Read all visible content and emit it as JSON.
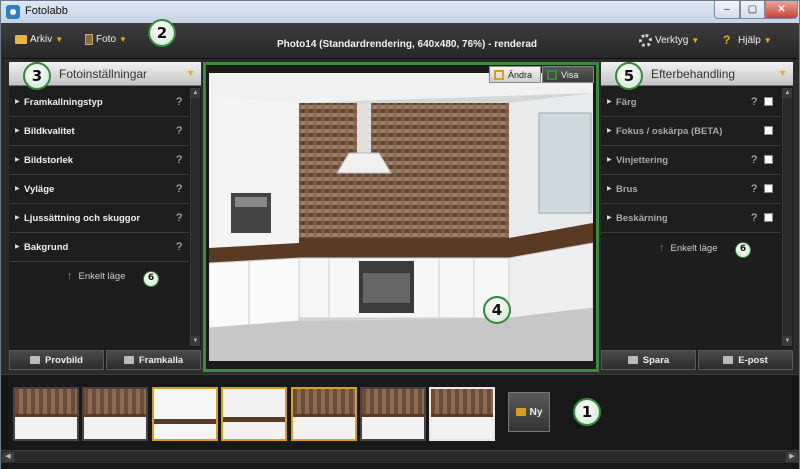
{
  "window": {
    "title": "Fotolabb",
    "buttons": {
      "minimize": "–",
      "maximize": "▢",
      "close": "✕"
    }
  },
  "toolbar": {
    "arkiv": "Arkiv",
    "foto": "Foto",
    "document_title": "Photo14 (Standardrendering, 640x480, 76%) - renderad",
    "verktyg": "Verktyg",
    "hjalp": "Hjälp",
    "arrow": "▼"
  },
  "callouts": {
    "c1": "1",
    "c2": "2",
    "c3": "3",
    "c4": "4",
    "c5": "5",
    "c6": "6"
  },
  "left_panel": {
    "title": "Fotoinställningar",
    "items": [
      {
        "label": "Framkallningstyp"
      },
      {
        "label": "Bildkvalitet"
      },
      {
        "label": "Bildstorlek"
      },
      {
        "label": "Vyläge"
      },
      {
        "label": "Ljussättning och skuggor"
      },
      {
        "label": "Bakgrund"
      }
    ],
    "help_mark": "?",
    "simple_mode": "Enkelt läge",
    "buttons": {
      "provbild": "Provbild",
      "framkalla": "Framkalla"
    }
  },
  "viewport": {
    "andra": "Ändra",
    "visa": "Visa"
  },
  "right_panel": {
    "title": "Efterbehandling",
    "items": [
      {
        "label": "Färg",
        "help": true,
        "checked": false
      },
      {
        "label": "Fokus / oskärpa (BETA)",
        "help": false,
        "checked": false
      },
      {
        "label": "Vinjettering",
        "help": true,
        "checked": false
      },
      {
        "label": "Brus",
        "help": true,
        "checked": false
      },
      {
        "label": "Beskärning",
        "help": true,
        "checked": false
      }
    ],
    "simple_mode": "Enkelt läge",
    "buttons": {
      "spara": "Spara",
      "epost": "E-post"
    }
  },
  "filmstrip": {
    "thumbnails": [
      "thumb-1",
      "thumb-2",
      "thumb-3",
      "thumb-4",
      "thumb-5",
      "thumb-6",
      "thumb-7"
    ],
    "new_label": "Ny"
  },
  "colors": {
    "accent": "#e9b000",
    "viewport_border": "#3d8a3d",
    "panel_bg": "#1d1d1d"
  }
}
